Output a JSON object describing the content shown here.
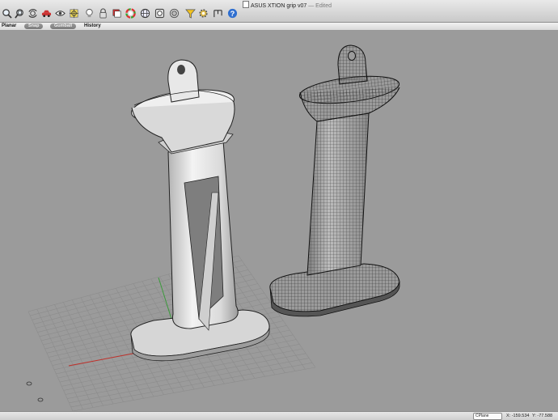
{
  "window": {
    "title": "ASUS XTION grip v07",
    "title_separator": "—",
    "status": "Edited"
  },
  "toolbar": {
    "icons": [
      "zoom-icon",
      "zoom-window-icon",
      "rotate-view-icon",
      "car-icon",
      "eye-icon",
      "select-icon",
      "lightbulb-icon",
      "lock-icon",
      "layers-icon",
      "color-wheel-icon",
      "globe-icon",
      "snapshot-icon",
      "filter-icon",
      "gear-icon",
      "dimension-icon",
      "help-icon"
    ]
  },
  "modebar": {
    "planar": "Planar",
    "snap": "Snap",
    "gumball": "Gumball",
    "history": "History"
  },
  "viewport": {
    "background": "#9b9b9b",
    "grid_color": "#8c8c8c",
    "x_axis_color": "#c0302a",
    "y_axis_color": "#3a9a3a"
  },
  "statusbar": {
    "cplane": "CPlane",
    "x": "X: -159.534",
    "y": "Y: -77.588"
  }
}
